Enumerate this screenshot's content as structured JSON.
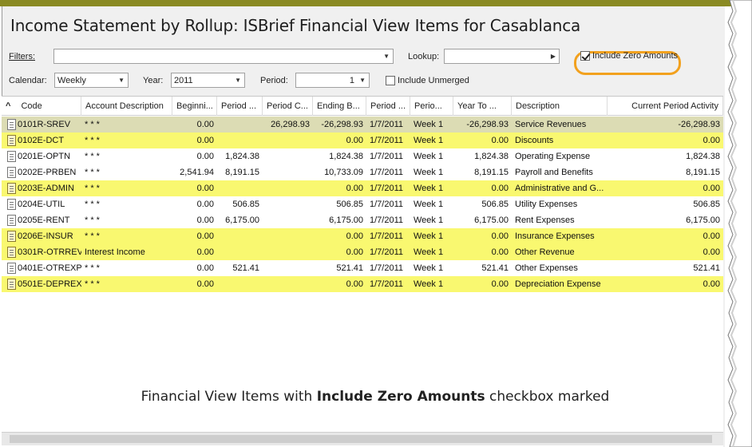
{
  "title": "Income Statement by Rollup: ISBrief Financial View Items for Casablanca",
  "filters": {
    "label": "Filters:",
    "value": ""
  },
  "lookup": {
    "label": "Lookup:",
    "value": ""
  },
  "include_zero": {
    "label": "Include Zero Amounts",
    "checked": true
  },
  "calendar": {
    "label": "Calendar:",
    "value": "Weekly"
  },
  "year": {
    "label": "Year:",
    "value": "2011"
  },
  "period": {
    "label": "Period:",
    "value": "1"
  },
  "include_unmerged": {
    "label": "Include Unmerged",
    "checked": false
  },
  "columns": [
    "Code",
    "Account Description",
    "Beginni...",
    "Period ...",
    "Period C...",
    "Ending B...",
    "Period ...",
    "Perio...",
    "Year To ...",
    "Description",
    "Current Period Activity"
  ],
  "rows": [
    {
      "code": "0101R-SREV",
      "acct": "* * *",
      "beg": "0.00",
      "pd": "",
      "pc": "26,298.93",
      "end": "-26,298.93",
      "date": "1/7/2011",
      "per": "Week 1",
      "ytd": "-26,298.93",
      "desc": "Service Revenues",
      "cur": "-26,298.93",
      "style": "sel"
    },
    {
      "code": "0102E-DCT",
      "acct": "* * *",
      "beg": "0.00",
      "pd": "",
      "pc": "",
      "end": "0.00",
      "date": "1/7/2011",
      "per": "Week 1",
      "ytd": "0.00",
      "desc": "Discounts",
      "cur": "0.00",
      "style": "z"
    },
    {
      "code": "0201E-OPTN",
      "acct": "* * *",
      "beg": "0.00",
      "pd": "1,824.38",
      "pc": "",
      "end": "1,824.38",
      "date": "1/7/2011",
      "per": "Week 1",
      "ytd": "1,824.38",
      "desc": "Operating Expense",
      "cur": "1,824.38",
      "style": ""
    },
    {
      "code": "0202E-PRBEN",
      "acct": "* * *",
      "beg": "2,541.94",
      "pd": "8,191.15",
      "pc": "",
      "end": "10,733.09",
      "date": "1/7/2011",
      "per": "Week 1",
      "ytd": "8,191.15",
      "desc": "Payroll and Benefits",
      "cur": "8,191.15",
      "style": ""
    },
    {
      "code": "0203E-ADMIN",
      "acct": "* * *",
      "beg": "0.00",
      "pd": "",
      "pc": "",
      "end": "0.00",
      "date": "1/7/2011",
      "per": "Week 1",
      "ytd": "0.00",
      "desc": "Administrative and G...",
      "cur": "0.00",
      "style": "z"
    },
    {
      "code": "0204E-UTIL",
      "acct": "* * *",
      "beg": "0.00",
      "pd": "506.85",
      "pc": "",
      "end": "506.85",
      "date": "1/7/2011",
      "per": "Week 1",
      "ytd": "506.85",
      "desc": "Utility Expenses",
      "cur": "506.85",
      "style": ""
    },
    {
      "code": "0205E-RENT",
      "acct": "* * *",
      "beg": "0.00",
      "pd": "6,175.00",
      "pc": "",
      "end": "6,175.00",
      "date": "1/7/2011",
      "per": "Week 1",
      "ytd": "6,175.00",
      "desc": "Rent Expenses",
      "cur": "6,175.00",
      "style": ""
    },
    {
      "code": "0206E-INSUR",
      "acct": "* * *",
      "beg": "0.00",
      "pd": "",
      "pc": "",
      "end": "0.00",
      "date": "1/7/2011",
      "per": "Week 1",
      "ytd": "0.00",
      "desc": "Insurance Expenses",
      "cur": "0.00",
      "style": "z"
    },
    {
      "code": "0301R-OTRREV",
      "acct": "Interest Income",
      "beg": "0.00",
      "pd": "",
      "pc": "",
      "end": "0.00",
      "date": "1/7/2011",
      "per": "Week 1",
      "ytd": "0.00",
      "desc": "Other Revenue",
      "cur": "0.00",
      "style": "z"
    },
    {
      "code": "0401E-OTREXP",
      "acct": "* * *",
      "beg": "0.00",
      "pd": "521.41",
      "pc": "",
      "end": "521.41",
      "date": "1/7/2011",
      "per": "Week 1",
      "ytd": "521.41",
      "desc": "Other Expenses",
      "cur": "521.41",
      "style": ""
    },
    {
      "code": "0501E-DEPREX",
      "acct": "* * *",
      "beg": "0.00",
      "pd": "",
      "pc": "",
      "end": "0.00",
      "date": "1/7/2011",
      "per": "Week 1",
      "ytd": "0.00",
      "desc": "Depreciation Expense",
      "cur": "0.00",
      "style": "z"
    }
  ],
  "caption": {
    "pre": "Financial View Items with ",
    "bold": "Include Zero Amounts",
    "post": " checkbox marked"
  },
  "colors": {
    "zero_row": "#f9f870",
    "selected_row": "#dcdcb4",
    "highlight": "#f2a11e",
    "top_bar": "#8a8a23"
  }
}
